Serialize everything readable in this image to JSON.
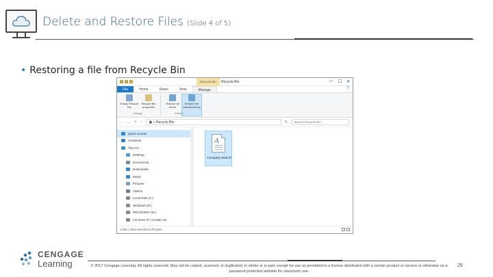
{
  "slide": {
    "title": "Delete and Restore Files",
    "subtitle": "(Slide 4 of 5)",
    "bullet": "Restoring a file from Recycle Bin",
    "page_number": "25",
    "copyright": "© 2017 Cengage Learning. All rights reserved. May not be copied, scanned, or duplicated, in whole or in part, except for use as permitted in a license distributed with a certain product or service or otherwise on a password-protected website for classroom use.",
    "brand_line1": "CENGAGE",
    "brand_line2": "Learning"
  },
  "window": {
    "title": "Recycle Bin",
    "context_tab": "Recycle Bin Tools",
    "tabs": [
      "File",
      "Home",
      "Share",
      "View",
      "Manage"
    ],
    "ribbon": {
      "buttons": [
        {
          "label": "Empty Recycle Bin",
          "icon": "empty-recycle-bin-icon"
        },
        {
          "label": "Recycle Bin properties",
          "icon": "recycle-bin-properties-icon"
        },
        {
          "label": "Restore all items",
          "icon": "restore-all-icon"
        },
        {
          "label": "Restore the selected items",
          "icon": "restore-selected-icon"
        }
      ],
      "group_manage": "Manage",
      "group_restore": "Restore"
    },
    "address": {
      "path": "Recycle Bin",
      "search_placeholder": "Search Recycle Bin"
    },
    "nav": [
      {
        "label": "Quick access",
        "icon": "star-icon",
        "color": "#2e86d6"
      },
      {
        "label": "OneDrive",
        "icon": "cloud-icon",
        "color": "#2e86d6"
      },
      {
        "label": "This PC",
        "icon": "pc-icon",
        "color": "#3c8fd1"
      },
      {
        "label": "Desktop",
        "icon": "desktop-icon",
        "color": "#4aa3e0"
      },
      {
        "label": "Documents",
        "icon": "documents-icon",
        "color": "#7a8a99"
      },
      {
        "label": "Downloads",
        "icon": "downloads-icon",
        "color": "#2e86d6"
      },
      {
        "label": "Music",
        "icon": "music-icon",
        "color": "#2e86d6"
      },
      {
        "label": "Pictures",
        "icon": "pictures-icon",
        "color": "#7a9ac0"
      },
      {
        "label": "Videos",
        "icon": "videos-icon",
        "color": "#6b7b8a"
      },
      {
        "label": "Local Disk (C:)",
        "icon": "disk-icon",
        "color": "#8a8a8a"
      },
      {
        "label": "Windows (D:)",
        "icon": "disk-icon",
        "color": "#8a8a8a"
      },
      {
        "label": "RECOVERY (E:)",
        "icon": "disk-icon",
        "color": "#8a8a8a"
      },
      {
        "label": "CD Drive (F:) Kodak CD",
        "icon": "cd-drive-icon",
        "color": "#8a8a8a"
      }
    ],
    "file": {
      "label": "Company Seal.rtf",
      "icon": "document-icon"
    },
    "status": "1 item    1 item selected  3.40 bytes"
  }
}
